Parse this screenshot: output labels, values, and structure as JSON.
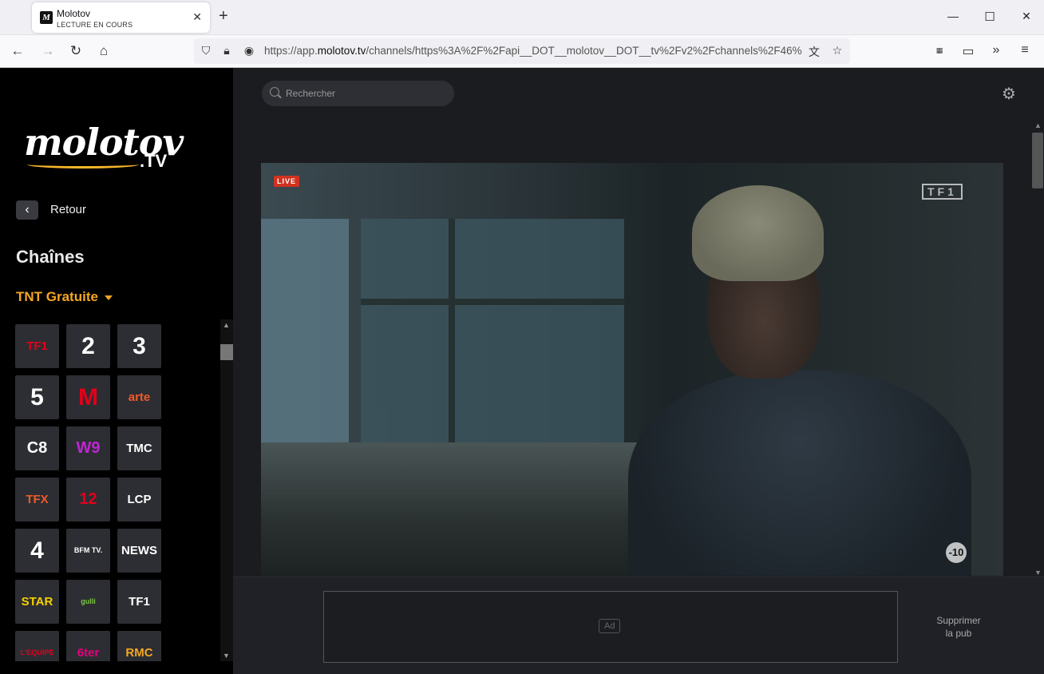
{
  "browser": {
    "tab": {
      "title": "Molotov",
      "subtitle": "LECTURE EN COURS",
      "favicon": "M"
    },
    "url_prefix": "https://app.",
    "url_domain": "molotov.tv",
    "url_rest": "/channels/https%3A%2F%2Fapi__DOT__molotov__DOT__tv%2Fv2%2Fchannels%2F46%"
  },
  "sidebar": {
    "logo": "molotov",
    "logo_suffix": ".TV",
    "back_label": "Retour",
    "title": "Chaînes",
    "category": "TNT Gratuite",
    "channels": [
      {
        "label": "TF1",
        "color": "#e2001a"
      },
      {
        "label": "2",
        "color": "#ffffff"
      },
      {
        "label": "3",
        "color": "#ffffff"
      },
      {
        "label": "5",
        "color": "#ffffff"
      },
      {
        "label": "M",
        "color": "#e2001a"
      },
      {
        "label": "arte",
        "color": "#f05a28"
      },
      {
        "label": "C8",
        "color": "#ffffff"
      },
      {
        "label": "W9",
        "color": "#c026d3"
      },
      {
        "label": "TMC",
        "color": "#ffffff"
      },
      {
        "label": "TFX",
        "color": "#f05a28"
      },
      {
        "label": "12",
        "color": "#e2001a"
      },
      {
        "label": "LCP",
        "color": "#ffffff"
      },
      {
        "label": "4",
        "color": "#ffffff"
      },
      {
        "label": "BFM TV.",
        "color": "#ffffff"
      },
      {
        "label": "NEWS",
        "color": "#ffffff"
      },
      {
        "label": "STAR",
        "color": "#f5d000"
      },
      {
        "label": "gulli",
        "color": "#7ac943"
      },
      {
        "label": "TF1",
        "color": "#ffffff"
      },
      {
        "label": "L'EQUIPE",
        "color": "#e2001a"
      },
      {
        "label": "6ter",
        "color": "#e5007d"
      },
      {
        "label": "RMC",
        "color": "#f5a623"
      }
    ]
  },
  "main": {
    "search_placeholder": "Rechercher",
    "player": {
      "live_label": "LIVE",
      "channel_watermark": "TF1",
      "rating": "-10"
    },
    "ad": {
      "tag": "Ad",
      "remove_line1": "Supprimer",
      "remove_line2": "la pub"
    }
  }
}
